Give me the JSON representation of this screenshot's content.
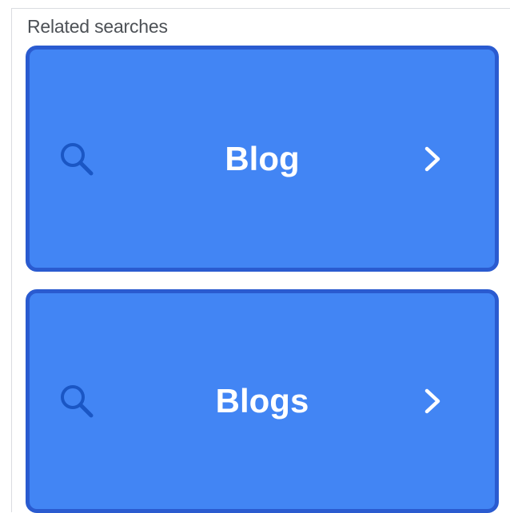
{
  "related": {
    "heading": "Related searches",
    "items": [
      {
        "label": "Blog",
        "icon": "search-icon",
        "action_icon": "chevron-right-icon"
      },
      {
        "label": "Blogs",
        "icon": "search-icon",
        "action_icon": "chevron-right-icon"
      }
    ]
  },
  "colors": {
    "card_fill": "#4285f4",
    "card_border": "#2a5bd0",
    "icon_tint": "#1a56c4",
    "text": "#ffffff"
  }
}
